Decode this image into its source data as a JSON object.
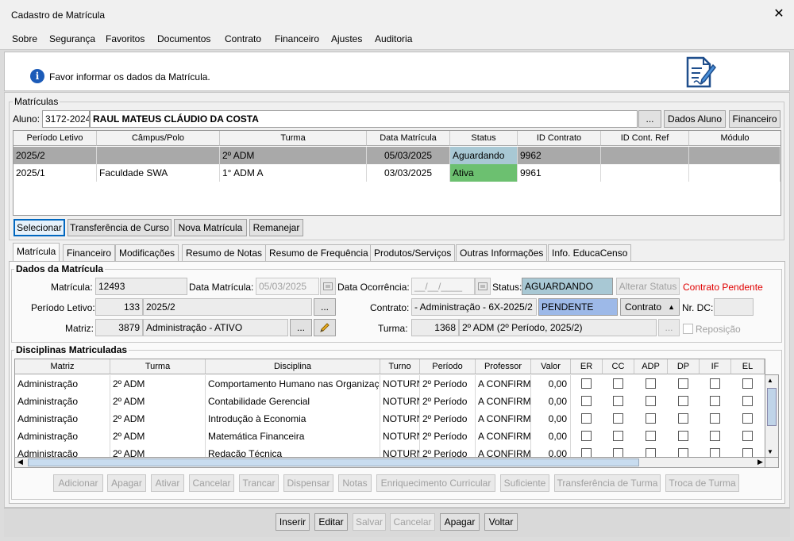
{
  "window": {
    "title": "Cadastro de Matrícula",
    "close": "✕"
  },
  "menu": [
    "Sobre",
    "Segurança",
    "Favoritos",
    "Documentos",
    "Contrato",
    "Financeiro",
    "Ajustes",
    "Auditoria"
  ],
  "info": {
    "icon": "i",
    "text": "Favor informar os dados da Matrícula."
  },
  "matriculas": {
    "group_label": "Matrículas",
    "aluno_label": "Aluno:",
    "aluno_code": "3172-2024",
    "aluno_name": "RAUL MATEUS CLÁUDIO DA COSTA",
    "ellipsis": "...",
    "dados_aluno": "Dados Aluno",
    "financeiro": "Financeiro",
    "columns": [
      "Período Letivo",
      "Câmpus/Polo",
      "Turma",
      "Data Matrícula",
      "Status",
      "ID Contrato",
      "ID Cont. Ref",
      "Módulo"
    ],
    "rows": [
      {
        "periodo": "2025/2",
        "campus": "",
        "turma": "2º ADM",
        "data": "05/03/2025",
        "status": "Aguardando",
        "id_contrato": "9962",
        "id_ref": "",
        "modulo": ""
      },
      {
        "periodo": "2025/1",
        "campus": "Faculdade SWA",
        "turma": "1° ADM A",
        "data": "03/03/2025",
        "status": "Ativa",
        "id_contrato": "9961",
        "id_ref": "",
        "modulo": ""
      }
    ],
    "buttons": [
      "Selecionar",
      "Transferência de Curso",
      "Nova Matrícula",
      "Remanejar"
    ]
  },
  "tabs": [
    "Matrícula",
    "Financeiro",
    "Modificações",
    "Resumo de Notas",
    "Resumo de Frequência",
    "Produtos/Serviços",
    "Outras Informações",
    "Info. EducaCenso"
  ],
  "dados": {
    "group_label": "Dados da Matrícula",
    "matricula_label": "Matrícula:",
    "matricula": "12493",
    "data_matricula_label": "Data Matrícula:",
    "data_matricula": "05/03/2025",
    "data_ocorrencia_label": "Data Ocorrência:",
    "data_ocorrencia": "__/__/____",
    "status_label": "Status:",
    "status": "AGUARDANDO",
    "alterar_status": "Alterar Status",
    "contrato_pendente": "Contrato Pendente",
    "periodo_label": "Período Letivo:",
    "periodo_code": "133",
    "periodo": "2025/2",
    "contrato_label": "Contrato:",
    "contrato": "- Administração - 6X-2025/2",
    "contrato_status": "PENDENTE",
    "contrato_btn": "Contrato",
    "nr_dc_label": "Nr. DC:",
    "nr_dc": "",
    "matriz_label": "Matriz:",
    "matriz_code": "3879",
    "matriz": "Administração - ATIVO",
    "turma_label": "Turma:",
    "turma_code": "1368",
    "turma": "2º ADM (2º Período, 2025/2)",
    "reposicao": "Reposição"
  },
  "disciplinas": {
    "group_label": "Disciplinas Matriculadas",
    "columns": [
      "Matriz",
      "Turma",
      "Disciplina",
      "Turno",
      "Período",
      "Professor",
      "Valor",
      "ER",
      "CC",
      "ADP",
      "DP",
      "IF",
      "EL"
    ],
    "rows": [
      {
        "matriz": "Administração",
        "turma": "2º ADM",
        "disciplina": "Comportamento Humano nas Organizações",
        "turno": "NOTURNO",
        "periodo": "2º Período",
        "professor": "A CONFIRMAR",
        "valor": "0,00"
      },
      {
        "matriz": "Administração",
        "turma": "2º ADM",
        "disciplina": "Contabilidade Gerencial",
        "turno": "NOTURNO",
        "periodo": "2º Período",
        "professor": "A CONFIRMAR",
        "valor": "0,00"
      },
      {
        "matriz": "Administração",
        "turma": "2º ADM",
        "disciplina": "Introdução à Economia",
        "turno": "NOTURNO",
        "periodo": "2º Período",
        "professor": "A CONFIRMAR",
        "valor": "0,00"
      },
      {
        "matriz": "Administração",
        "turma": "2º ADM",
        "disciplina": "Matemática Financeira",
        "turno": "NOTURNO",
        "periodo": "2º Período",
        "professor": "A CONFIRMAR",
        "valor": "0,00"
      },
      {
        "matriz": "Administração",
        "turma": "2º ADM",
        "disciplina": "Redação Técnica",
        "turno": "NOTURNO",
        "periodo": "2º Período",
        "professor": "A CONFIRMAR",
        "valor": "0,00"
      }
    ],
    "buttons": [
      "Adicionar",
      "Apagar",
      "Ativar",
      "Cancelar",
      "Trancar",
      "Dispensar",
      "Notas",
      "Enriquecimento Curricular",
      "Suficiente",
      "Transferência de Turma",
      "Troca de Turma"
    ]
  },
  "footer": [
    "Inserir",
    "Editar",
    "Salvar",
    "Cancelar",
    "Apagar",
    "Voltar"
  ],
  "colors": {
    "aguardando": "#a8c8d4",
    "ativa": "#6cc070",
    "pendente": "#9db9e8",
    "selected_row": "#a9a9a9",
    "contrato_pendente": "#e00000"
  }
}
